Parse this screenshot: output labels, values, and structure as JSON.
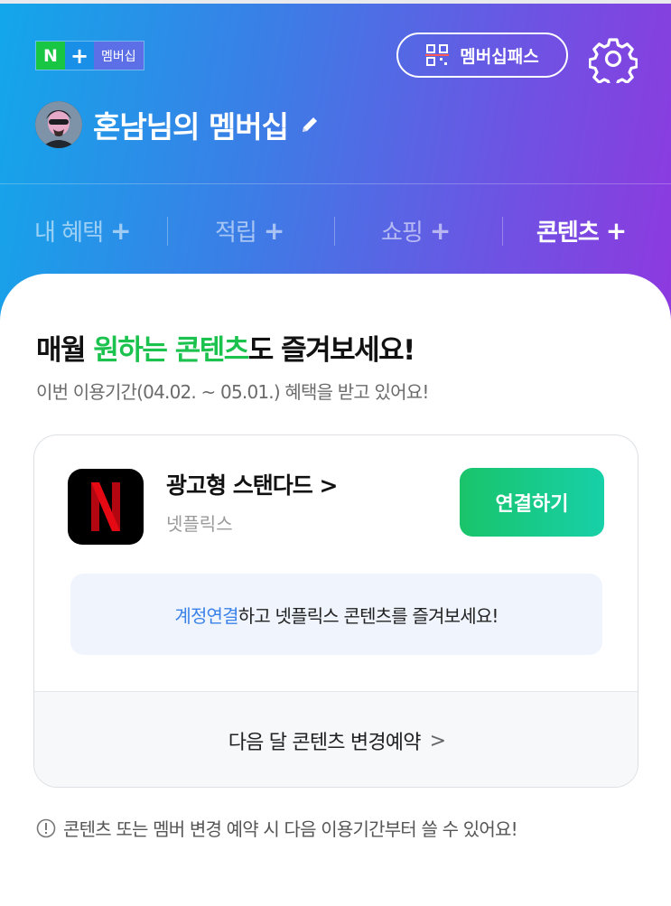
{
  "header": {
    "badge_n": "N",
    "badge_plus": "+",
    "badge_text": "멤버십",
    "pass_button": "멤버십패스",
    "profile_name": "혼남님의 멤버십",
    "gradient_colors": [
      "#12a7ea",
      "#8e39df"
    ]
  },
  "tabs": [
    {
      "label": "내 혜택",
      "plus": "+",
      "active": false
    },
    {
      "label": "적립",
      "plus": "+",
      "active": false
    },
    {
      "label": "쇼핑",
      "plus": "+",
      "active": false
    },
    {
      "label": "콘텐츠",
      "plus": "+",
      "active": true
    }
  ],
  "content": {
    "headline_pre": "매월 ",
    "headline_highlight": "원하는 콘텐츠",
    "headline_post": "도 즐겨보세요!",
    "subline": "이번 이용기간(04.02. ~ 05.01.) 혜택을 받고 있어요!",
    "accent_color": "#1bc24d"
  },
  "card": {
    "product_name": "광고형 스탠다드",
    "product_chevron": ">",
    "product_provider": "넷플릭스",
    "logo_letter": "N",
    "connect_button": "연결하기",
    "info_link": "계정연결",
    "info_text": "하고 넷플릭스 콘텐츠를 즐겨보세요!",
    "footer_text": "다음 달 콘텐츠 변경예약",
    "footer_chevron": ">"
  },
  "notice": {
    "text": "콘텐츠 또는 멤버 변경 예약 시 다음 이용기간부터 쓸 수 있어요!"
  },
  "icons": [
    "qr-pass-icon",
    "gear-icon",
    "pencil-icon",
    "chevron-right-icon",
    "info-circle-icon"
  ]
}
